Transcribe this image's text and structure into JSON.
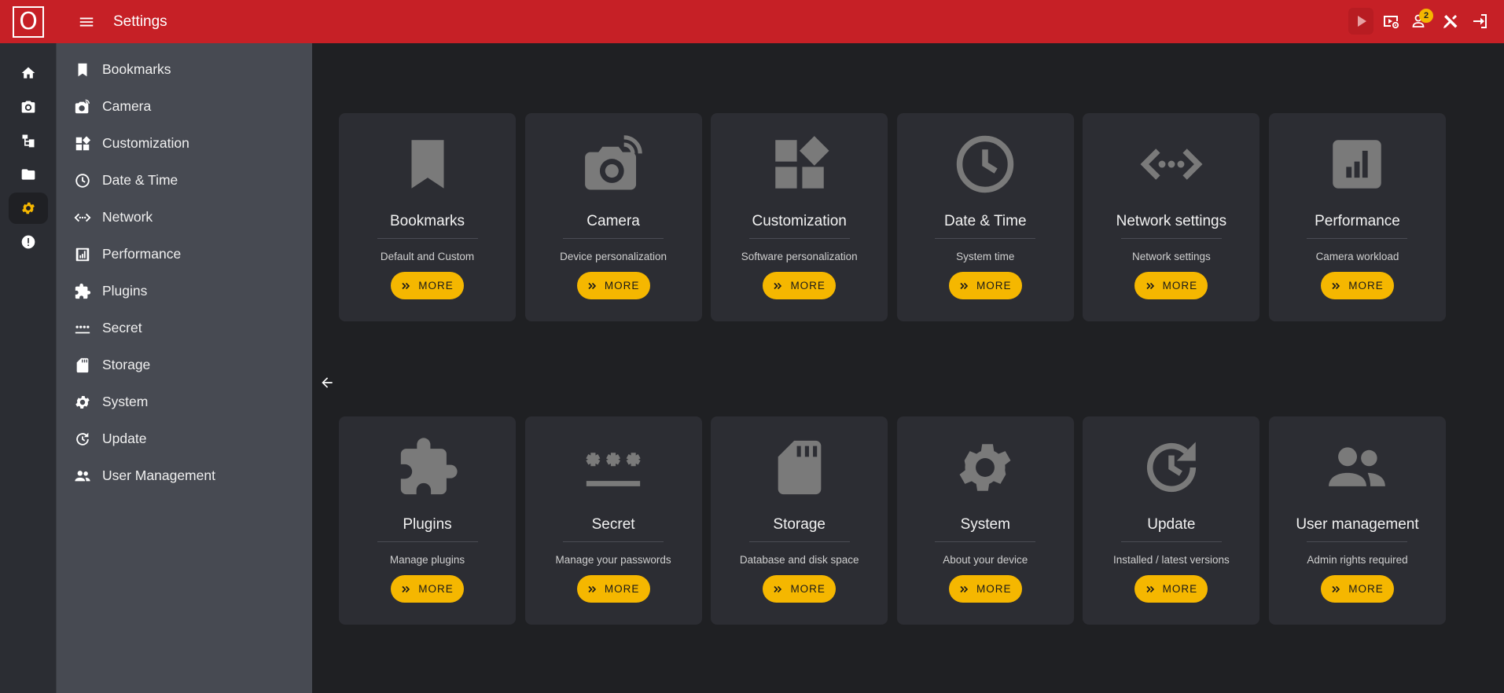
{
  "app": {
    "logo_letter": "O",
    "title": "Settings",
    "notification_count": "2",
    "accent_color": "#f5b700",
    "header_color": "#c62026"
  },
  "header_actions": [
    {
      "icon": "play-icon"
    },
    {
      "icon": "screencast-settings-icon"
    },
    {
      "icon": "users-icon"
    },
    {
      "icon": "tools-icon"
    },
    {
      "icon": "logout-icon"
    }
  ],
  "rail": [
    {
      "icon": "home-icon",
      "active": false
    },
    {
      "icon": "camera-icon",
      "active": false
    },
    {
      "icon": "tree-icon",
      "active": false
    },
    {
      "icon": "folder-icon",
      "active": false
    },
    {
      "icon": "gear-icon",
      "active": true
    },
    {
      "icon": "alert-icon",
      "active": false
    }
  ],
  "sidebar": {
    "items": [
      {
        "label": "Bookmarks",
        "icon": "bookmark-icon"
      },
      {
        "label": "Camera",
        "icon": "camera-icon"
      },
      {
        "label": "Customization",
        "icon": "widgets-icon"
      },
      {
        "label": "Date & Time",
        "icon": "clock-icon"
      },
      {
        "label": "Network",
        "icon": "network-icon"
      },
      {
        "label": "Performance",
        "icon": "performance-icon"
      },
      {
        "label": "Plugins",
        "icon": "puzzle-icon"
      },
      {
        "label": "Secret",
        "icon": "password-icon"
      },
      {
        "label": "Storage",
        "icon": "sd-card-icon"
      },
      {
        "label": "System",
        "icon": "gear-icon"
      },
      {
        "label": "Update",
        "icon": "update-icon"
      },
      {
        "label": "User Management",
        "icon": "users-icon"
      }
    ]
  },
  "main": {
    "more_label": "MORE",
    "cards": [
      {
        "title": "Bookmarks",
        "subtitle": "Default and Custom",
        "icon": "bookmark-icon"
      },
      {
        "title": "Camera",
        "subtitle": "Device personalization",
        "icon": "camera-icon"
      },
      {
        "title": "Customization",
        "subtitle": "Software personalization",
        "icon": "widgets-icon"
      },
      {
        "title": "Date & Time",
        "subtitle": "System time",
        "icon": "clock-icon"
      },
      {
        "title": "Network settings",
        "subtitle": "Network settings",
        "icon": "network-icon"
      },
      {
        "title": "Performance",
        "subtitle": "Camera workload",
        "icon": "performance-icon"
      },
      {
        "title": "Plugins",
        "subtitle": "Manage plugins",
        "icon": "puzzle-icon"
      },
      {
        "title": "Secret",
        "subtitle": "Manage your passwords",
        "icon": "password-icon"
      },
      {
        "title": "Storage",
        "subtitle": "Database and disk space",
        "icon": "sd-card-icon"
      },
      {
        "title": "System",
        "subtitle": "About your device",
        "icon": "gear-icon"
      },
      {
        "title": "Update",
        "subtitle": "Installed / latest versions",
        "icon": "update-icon"
      },
      {
        "title": "User management",
        "subtitle": "Admin rights required",
        "icon": "users-icon"
      }
    ]
  }
}
